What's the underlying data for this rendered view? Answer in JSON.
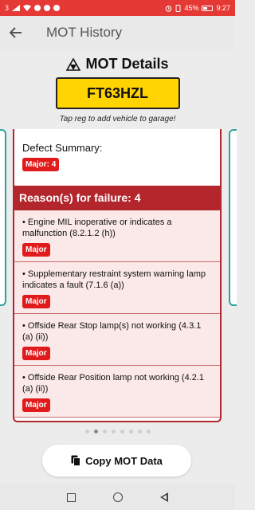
{
  "status_bar": {
    "carrier": "3",
    "battery": "45%",
    "time": "9:27"
  },
  "app_bar": {
    "title": "MOT History"
  },
  "header": {
    "title": "MOT Details",
    "registration": "FT63HZL",
    "hint": "Tap reg to add vehicle to garage!"
  },
  "defects": {
    "title": "Defect Summary:",
    "badge": "Major: 4"
  },
  "failure": {
    "heading": "Reason(s) for failure: 4",
    "reasons": [
      {
        "text": "• Engine MIL inoperative or indicates a malfunction (8.2.1.2 (h))",
        "badge": "Major"
      },
      {
        "text": "• Supplementary restraint system warning lamp indicates a fault (7.1.6 (a))",
        "badge": "Major"
      },
      {
        "text": "• Offside Rear Stop lamp(s) not working (4.3.1 (a) (ii))",
        "badge": "Major"
      },
      {
        "text": "• Offside Rear Position lamp not working (4.2.1 (a) (ii))",
        "badge": "Major"
      }
    ]
  },
  "pager": {
    "count": 8,
    "active_index": 1
  },
  "copy_button": {
    "label": "Copy MOT Data"
  },
  "colors": {
    "status_bar": "#e53935",
    "plate": "#ffd400",
    "failure": "#b3262b",
    "badge": "#e11b1b",
    "side_card": "#2aa39a"
  },
  "icons": {
    "back": "arrow-left-icon",
    "title": "mot-tester-icon",
    "copy": "copy-icon"
  }
}
